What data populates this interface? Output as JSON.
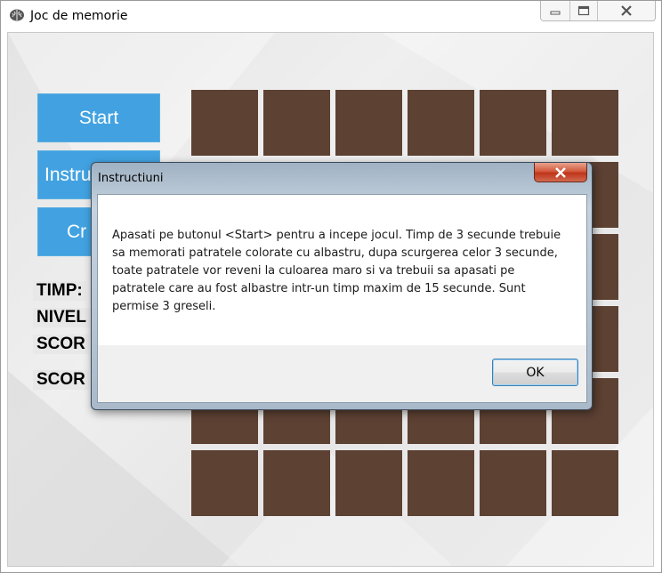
{
  "window": {
    "title": "Joc de memorie",
    "icon": "brain-icon",
    "controls": [
      "minimize-icon",
      "maximize-icon",
      "close-icon"
    ]
  },
  "menu": {
    "start_label": "Start",
    "instructions_label": "Instru",
    "credits_label": "Cr"
  },
  "stats": {
    "time_label": "TIMP:",
    "level_label": "NIVEL",
    "score_label": "SCOR",
    "highscore_label": "SCOR"
  },
  "grid": {
    "rows": 6,
    "cols": 6,
    "tile_color": "#5d4133"
  },
  "dialog": {
    "title": "Instructiuni",
    "message": "Apasati pe butonul <Start> pentru a incepe jocul. Timp de 3 secunde trebuie sa memorati patratele colorate cu albastru, dupa scurgerea celor 3 secunde, toate patratele vor reveni la culoarea maro si va trebuii sa apasati pe patratele care au fost albastre intr-un timp maxim de 15 secunde. Sunt permise 3 greseli.",
    "ok_label": "OK"
  },
  "colors": {
    "accent_blue": "#42a2e1",
    "tile_brown": "#5d4133",
    "close_red": "#c94a2c"
  }
}
